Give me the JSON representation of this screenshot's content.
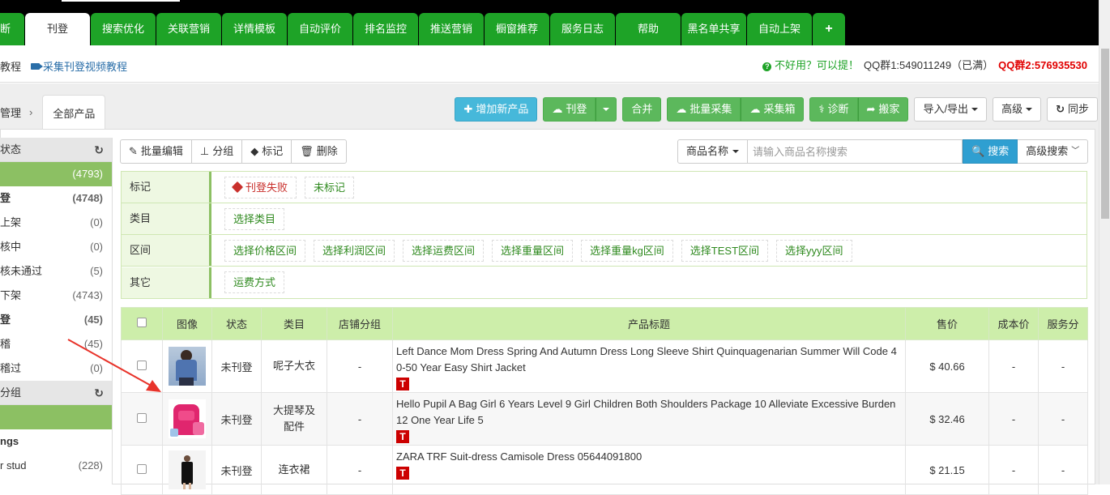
{
  "tabs": [
    {
      "label": "诊断",
      "shown": "断",
      "w": 30
    },
    {
      "label": "刊登",
      "shown": "刊登",
      "w": 80,
      "active": true
    },
    {
      "label": "搜索优化",
      "shown": "搜索优化",
      "w": 80
    },
    {
      "label": "关联营销",
      "shown": "关联营销",
      "w": 80
    },
    {
      "label": "详情模板",
      "shown": "详情模板",
      "w": 80
    },
    {
      "label": "自动评价",
      "shown": "自动评价",
      "w": 80
    },
    {
      "label": "排名监控",
      "shown": "排名监控",
      "w": 80
    },
    {
      "label": "推送营销",
      "shown": "推送营销",
      "w": 80
    },
    {
      "label": "橱窗推荐",
      "shown": "橱窗推荐",
      "w": 80
    },
    {
      "label": "服务日志",
      "shown": "服务日志",
      "w": 80
    },
    {
      "label": "帮助",
      "shown": "帮助",
      "w": 80
    },
    {
      "label": "黑名单共享",
      "shown": "黑名单共享",
      "w": 80
    },
    {
      "label": "自动上架",
      "shown": "自动上架",
      "w": 80
    },
    {
      "label": "+",
      "shown": "+",
      "w": 40
    }
  ],
  "subbar": {
    "left_link1": "教程",
    "left_link2": "采集刊登视频教程",
    "feedback": "不好用？可以提！",
    "qq1": "QQ群1:549011249（已满）",
    "qq2": "QQ群2:576935530"
  },
  "crumb": {
    "parent": "管理",
    "sep": "›",
    "current": "全部产品"
  },
  "top_buttons": {
    "add": "增加新产品",
    "publish": "刊登",
    "merge": "合并",
    "batch_collect": "批量采集",
    "collect_box": "采集箱",
    "diagnose": "诊断",
    "move": "搬家",
    "import_export": "导入/导出",
    "advanced": "高级",
    "sync": "同步"
  },
  "sidebar": {
    "status_head": "状态",
    "items": [
      {
        "label": "",
        "count": "(4793)",
        "sel": true
      },
      {
        "label": "登",
        "count": "(4748)",
        "bold": true
      },
      {
        "label": "上架",
        "count": "(0)"
      },
      {
        "label": "核中",
        "count": "(0)"
      },
      {
        "label": "核未通过",
        "count": "(5)"
      },
      {
        "label": "下架",
        "count": "(4743)"
      },
      {
        "label": "登",
        "count": "(45)",
        "bold": true
      },
      {
        "label": "稽",
        "count": "(45)"
      },
      {
        "label": "稽过",
        "count": "(0)"
      }
    ],
    "group_head": "分组",
    "group_items": [
      {
        "label": "",
        "count": "",
        "sel": true
      },
      {
        "label": "ngs",
        "count": "",
        "bold": true
      },
      {
        "label": "r stud",
        "count": "(228)"
      }
    ]
  },
  "toolbar2": {
    "batch_edit": "批量编辑",
    "group": "分组",
    "mark": "标记",
    "delete": "删除"
  },
  "search": {
    "field": "商品名称",
    "placeholder": "请输入商品名称搜索",
    "button": "搜索",
    "advanced": "高级搜索"
  },
  "filters": [
    {
      "label": "标记",
      "options": [
        "刊登失败",
        "未标记"
      ]
    },
    {
      "label": "类目",
      "options": [
        "选择类目"
      ]
    },
    {
      "label": "区间",
      "options": [
        "选择价格区间",
        "选择利润区间",
        "选择运费区间",
        "选择重量区间",
        "选择重量kg区间",
        "选择TEST区间",
        "选择yyy区间"
      ]
    },
    {
      "label": "其它",
      "options": [
        "运费方式"
      ]
    }
  ],
  "table": {
    "headers": [
      "",
      "图像",
      "状态",
      "类目",
      "店铺分组",
      "产品标题",
      "售价",
      "成本价",
      "服务分"
    ],
    "rows": [
      {
        "status": "未刊登",
        "category": "呢子大衣",
        "group": "-",
        "title": "Left Dance Mom Dress Spring And Autumn Dress Long Sleeve Shirt Quinquagenarian Summer Will Code 40-50 Year Easy Shirt Jacket",
        "price": "$ 40.66",
        "cost": "-",
        "score": "-",
        "badge": "T"
      },
      {
        "status": "未刊登",
        "category": "大提琴及配件",
        "group": "-",
        "title": "Hello Pupil A Bag Girl 6 Years Level 9 Girl Children Both Shoulders Package 10 Alleviate Excessive Burden 12 One Year Life 5",
        "price": "$ 32.46",
        "cost": "-",
        "score": "-",
        "badge": "T"
      },
      {
        "status": "未刊登",
        "category": "连衣裙",
        "group": "-",
        "title": "ZARA TRF Suit-dress Camisole Dress 05644091800",
        "price": "$ 21.15",
        "cost": "-",
        "score": "-",
        "badge": "T"
      }
    ]
  },
  "colors": {
    "tab_green": "#1ea327",
    "accent_green": "#8cc063",
    "header_green": "#cdeeaa",
    "arrow_red": "#e8332a",
    "qq2_red": "#e10000"
  }
}
